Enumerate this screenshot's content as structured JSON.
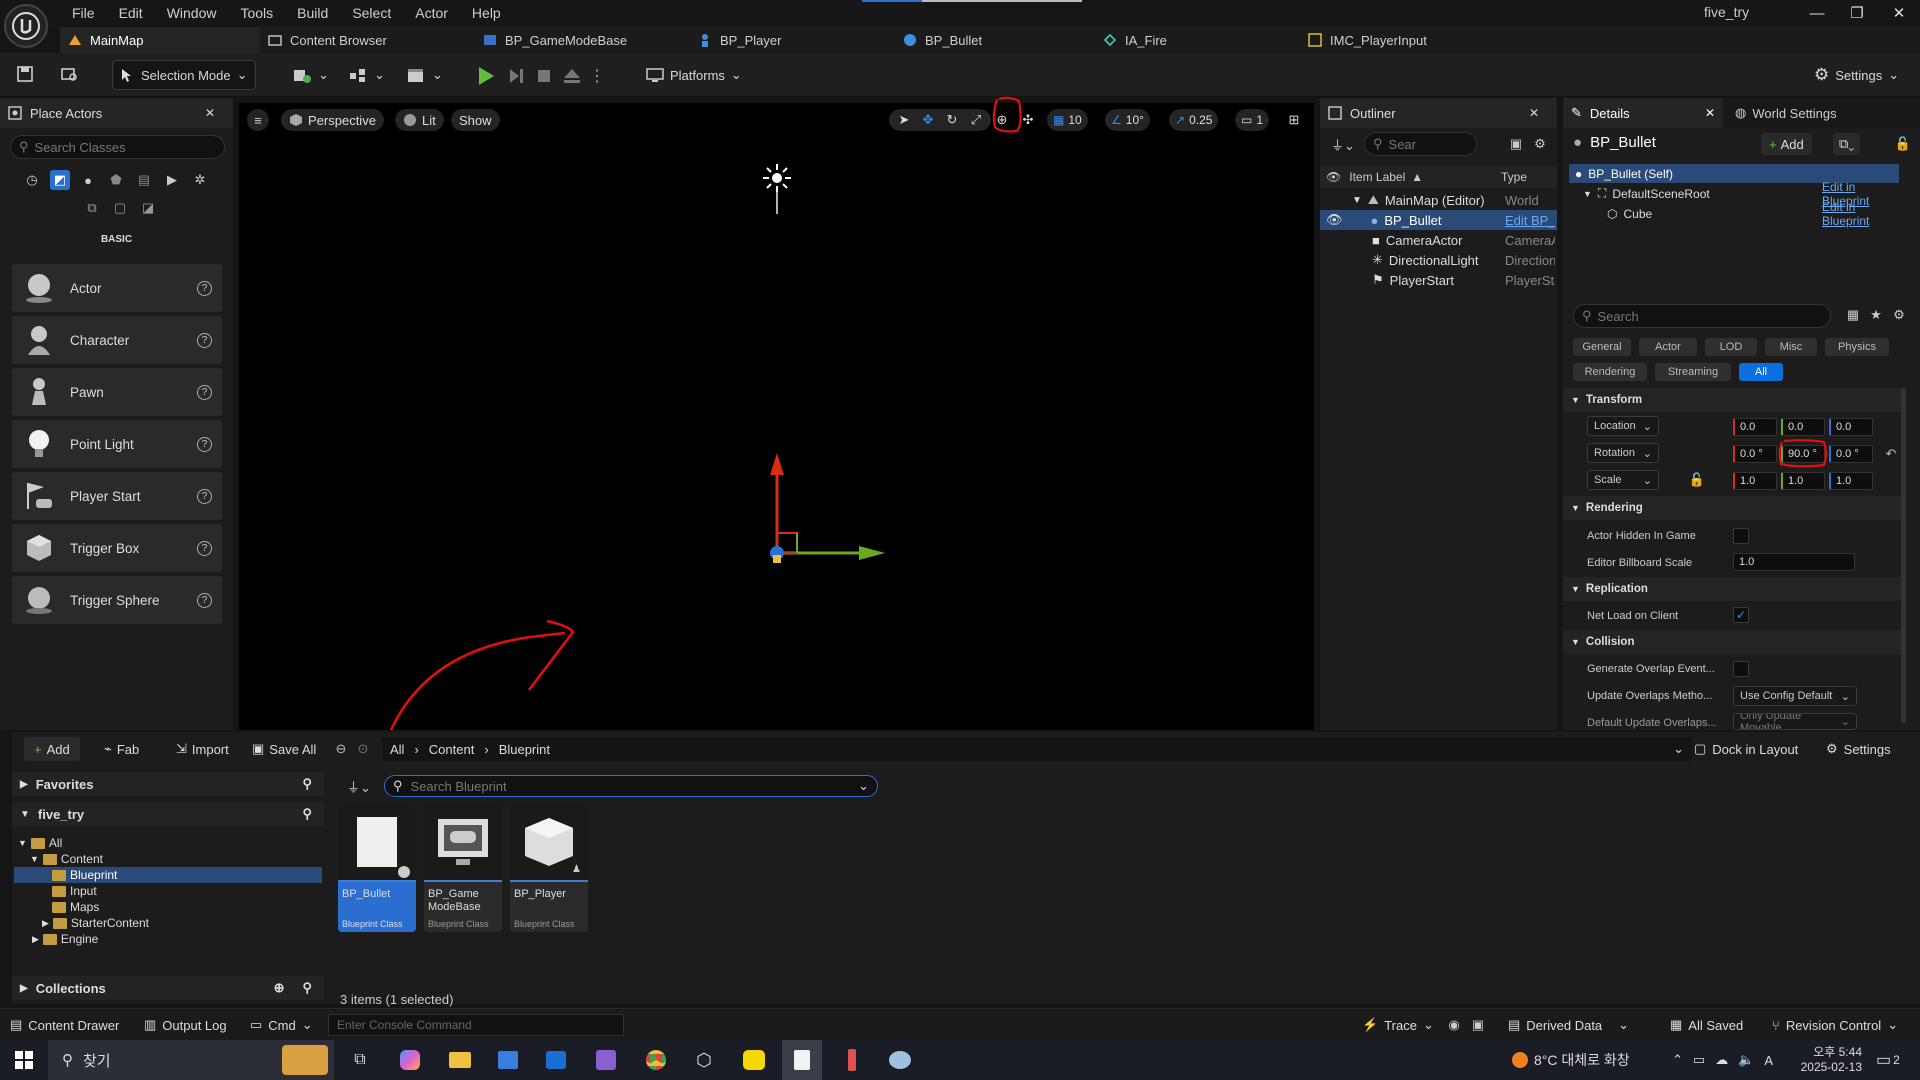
{
  "window": {
    "title": "five_try"
  },
  "menu": [
    "File",
    "Edit",
    "Window",
    "Tools",
    "Build",
    "Select",
    "Actor",
    "Help"
  ],
  "tabs": [
    {
      "label": "MainMap"
    },
    {
      "label": "Content Browser"
    },
    {
      "label": "BP_GameModeBase"
    },
    {
      "label": "BP_Player"
    },
    {
      "label": "BP_Bullet"
    },
    {
      "label": "IA_Fire"
    },
    {
      "label": "IMC_PlayerInput"
    }
  ],
  "toolbar": {
    "selection_mode": "Selection Mode",
    "platforms": "Platforms",
    "settings": "Settings"
  },
  "place_actors": {
    "tab": "Place Actors",
    "search_placeholder": "Search Classes",
    "category": "BASIC",
    "items": [
      "Actor",
      "Character",
      "Pawn",
      "Point Light",
      "Player Start",
      "Trigger Box",
      "Trigger Sphere"
    ]
  },
  "viewport": {
    "perspective": "Perspective",
    "lit": "Lit",
    "show": "Show",
    "grid_snap": "10",
    "rot_snap": "10°",
    "scale_snap": "0.25",
    "camera_speed": "1"
  },
  "outliner": {
    "tab": "Outliner",
    "search_placeholder": "Sear",
    "col_label": "Item Label",
    "col_type": "Type",
    "rows": [
      {
        "label": "MainMap (Editor)",
        "type": "World"
      },
      {
        "label": "BP_Bullet",
        "type": "Edit BP_B"
      },
      {
        "label": "CameraActor",
        "type": "CameraA"
      },
      {
        "label": "DirectionalLight",
        "type": "Direction"
      },
      {
        "label": "PlayerStart",
        "type": "PlayerSta"
      }
    ]
  },
  "details": {
    "tab": "Details",
    "tab2": "World Settings",
    "actor_name": "BP_Bullet",
    "add": "Add",
    "components": [
      {
        "label": "BP_Bullet (Self)",
        "link": ""
      },
      {
        "label": "DefaultSceneRoot",
        "link": "Edit in Blueprint"
      },
      {
        "label": "Cube",
        "link": "Edit in Blueprint"
      }
    ],
    "search_placeholder": "Search",
    "categories_row1": [
      "General",
      "Actor",
      "LOD",
      "Misc",
      "Physics"
    ],
    "categories_row2": [
      "Rendering",
      "Streaming",
      "All"
    ],
    "transform": {
      "header": "Transform",
      "location_label": "Location",
      "location": [
        "0.0",
        "0.0",
        "0.0"
      ],
      "rotation_label": "Rotation",
      "rotation": [
        "0.0 °",
        "90.0 °",
        "0.0 °"
      ],
      "scale_label": "Scale",
      "scale": [
        "1.0",
        "1.0",
        "1.0"
      ]
    },
    "rendering": {
      "header": "Rendering",
      "hidden_label": "Actor Hidden In Game",
      "billboard_label": "Editor Billboard Scale",
      "billboard_value": "1.0"
    },
    "replication": {
      "header": "Replication",
      "net_load_label": "Net Load on Client"
    },
    "collision": {
      "header": "Collision",
      "overlap_label": "Generate Overlap Event...",
      "update_label": "Update Overlaps Metho...",
      "update_value": "Use Config Default",
      "default_label": "Default Update Overlaps...",
      "default_value": "Only Update Movable"
    }
  },
  "content_browser": {
    "add": "Add",
    "fab": "Fab",
    "import": "Import",
    "save_all": "Save All",
    "breadcrumb": [
      "All",
      "Content",
      "Blueprint"
    ],
    "dock": "Dock in Layout",
    "settings": "Settings",
    "favorites": "Favorites",
    "project": "five_try",
    "tree": [
      "All",
      "Content",
      "Blueprint",
      "Input",
      "Maps",
      "StarterContent",
      "Engine"
    ],
    "collections": "Collections",
    "search_placeholder": "Search Blueprint",
    "assets": [
      {
        "name": "BP_Bullet",
        "class": "Blueprint Class"
      },
      {
        "name": "BP_Game ModeBase",
        "class": "Blueprint Class"
      },
      {
        "name": "BP_Player",
        "class": "Blueprint Class"
      }
    ],
    "count": "3 items (1 selected)"
  },
  "statusbar": {
    "content_drawer": "Content Drawer",
    "output_log": "Output Log",
    "cmd": "Cmd",
    "console_placeholder": "Enter Console Command",
    "trace": "Trace",
    "derived": "Derived Data",
    "saved": "All Saved",
    "revision": "Revision Control"
  },
  "taskbar": {
    "search": "찾기",
    "weather": "8°C 대체로 화창",
    "time": "오후 5:44",
    "date": "2025-02-13",
    "ime": "A",
    "notif": "2"
  },
  "colors": {
    "accent": "#0a70e0",
    "annotation": "#e01010",
    "x_axis": "#d62e12",
    "y_axis": "#6aaa22",
    "selection": "#2a4a78"
  }
}
